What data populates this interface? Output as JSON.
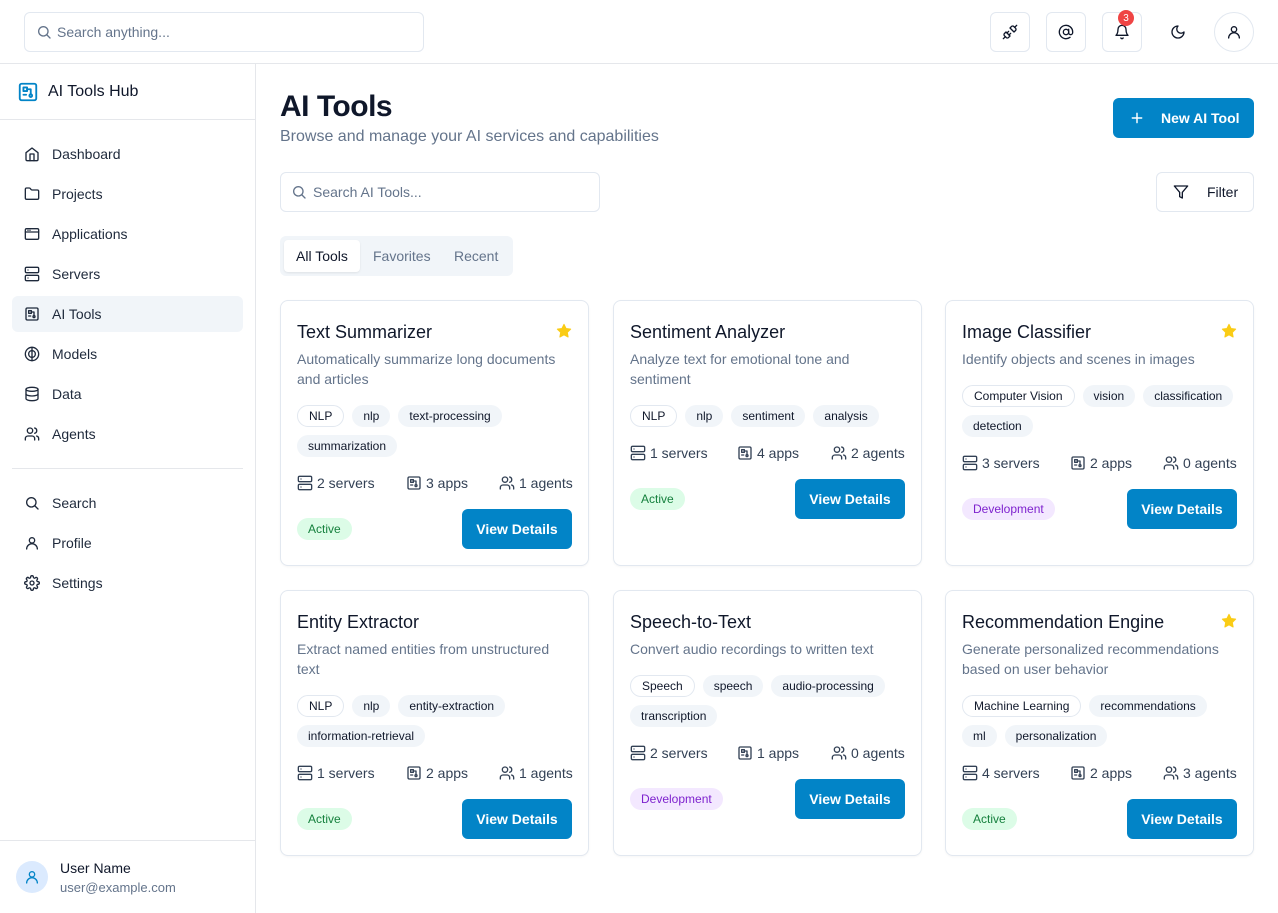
{
  "topbar": {
    "search_placeholder": "Search anything...",
    "notification_count": "3"
  },
  "sidebar": {
    "brand": "AI Tools Hub",
    "items": [
      {
        "label": "Dashboard"
      },
      {
        "label": "Projects"
      },
      {
        "label": "Applications"
      },
      {
        "label": "Servers"
      },
      {
        "label": "AI Tools"
      },
      {
        "label": "Models"
      },
      {
        "label": "Data"
      },
      {
        "label": "Agents"
      }
    ],
    "secondary": [
      {
        "label": "Search"
      },
      {
        "label": "Profile"
      },
      {
        "label": "Settings"
      }
    ],
    "user": {
      "name": "User Name",
      "email": "user@example.com"
    }
  },
  "main": {
    "title": "AI Tools",
    "subtitle": "Browse and manage your AI services and capabilities",
    "new_button": "New AI Tool",
    "search_placeholder": "Search AI Tools...",
    "filter_label": "Filter",
    "tabs": [
      {
        "label": "All Tools",
        "active": true
      },
      {
        "label": "Favorites",
        "active": false
      },
      {
        "label": "Recent",
        "active": false
      }
    ]
  },
  "colors": {
    "accent": "#0284c7",
    "star": "#facc15",
    "active_bg": "#dcfce7",
    "active_text": "#15803d",
    "dev_bg": "#f3e8ff",
    "dev_text": "#7e22ce"
  },
  "tools": [
    {
      "name": "Text Summarizer",
      "favorite": true,
      "description": "Automatically summarize long documents and articles",
      "category": "NLP",
      "tags": [
        "nlp",
        "text-processing",
        "summarization"
      ],
      "servers": "2 servers",
      "apps": "3 apps",
      "agents": "1 agents",
      "status": "Active",
      "button": "View Details"
    },
    {
      "name": "Sentiment Analyzer",
      "favorite": false,
      "description": "Analyze text for emotional tone and sentiment",
      "category": "NLP",
      "tags": [
        "nlp",
        "sentiment",
        "analysis"
      ],
      "servers": "1 servers",
      "apps": "4 apps",
      "agents": "2 agents",
      "status": "Active",
      "button": "View Details"
    },
    {
      "name": "Image Classifier",
      "favorite": true,
      "description": "Identify objects and scenes in images",
      "category": "Computer Vision",
      "tags": [
        "vision",
        "classification",
        "detection"
      ],
      "servers": "3 servers",
      "apps": "2 apps",
      "agents": "0 agents",
      "status": "Development",
      "button": "View Details"
    },
    {
      "name": "Entity Extractor",
      "favorite": false,
      "description": "Extract named entities from unstructured text",
      "category": "NLP",
      "tags": [
        "nlp",
        "entity-extraction",
        "information-retrieval"
      ],
      "servers": "1 servers",
      "apps": "2 apps",
      "agents": "1 agents",
      "status": "Active",
      "button": "View Details"
    },
    {
      "name": "Speech-to-Text",
      "favorite": false,
      "description": "Convert audio recordings to written text",
      "category": "Speech",
      "tags": [
        "speech",
        "audio-processing",
        "transcription"
      ],
      "servers": "2 servers",
      "apps": "1 apps",
      "agents": "0 agents",
      "status": "Development",
      "button": "View Details"
    },
    {
      "name": "Recommendation Engine",
      "favorite": true,
      "description": "Generate personalized recommendations based on user behavior",
      "category": "Machine Learning",
      "tags": [
        "recommendations",
        "ml",
        "personalization"
      ],
      "servers": "4 servers",
      "apps": "2 apps",
      "agents": "3 agents",
      "status": "Active",
      "button": "View Details"
    }
  ]
}
